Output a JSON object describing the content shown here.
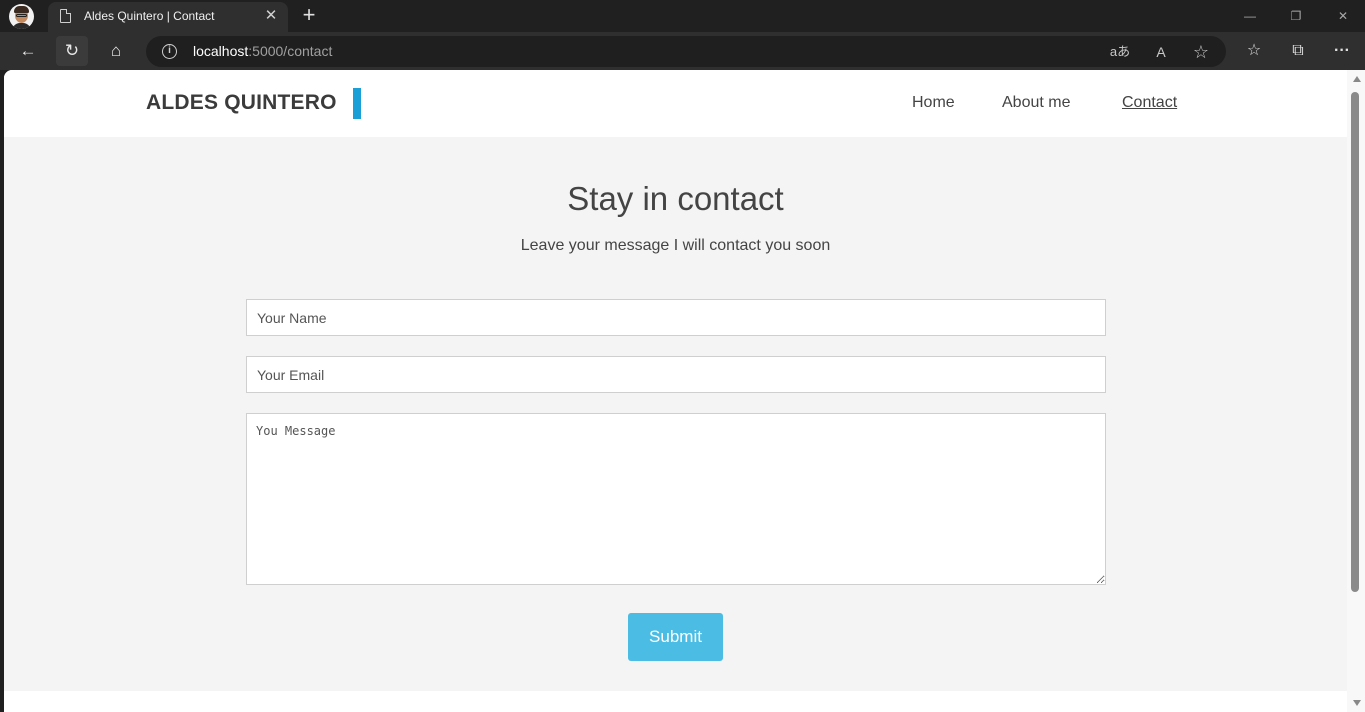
{
  "browser": {
    "tab_title": "Aldes Quintero | Contact",
    "tab_close_icon": "close-icon",
    "new_tab_icon": "plus-icon",
    "url_host": "localhost",
    "url_rest": ":5000/contact",
    "window_controls": {
      "minimize": "—",
      "restore": "❐",
      "close": "✕"
    },
    "toolbar_glyphs": {
      "back": "←",
      "reload": "↻",
      "home": "⌂",
      "info": "i",
      "translate": "aあ",
      "read_aloud": "A",
      "favorite": "☆",
      "favorites": "☆",
      "collections": "⧉",
      "more": "···"
    }
  },
  "site": {
    "logo": "ALDES QUINTERO",
    "accent_color": "#1a9fd6",
    "nav": {
      "home": "Home",
      "about": "About me",
      "contact": "Contact"
    }
  },
  "contact": {
    "heading": "Stay in contact",
    "subheading": "Leave your message I will contact you soon",
    "name_placeholder": "Your Name",
    "email_placeholder": "Your Email",
    "message_placeholder": "You Message",
    "submit_label": "Submit",
    "submit_color": "#4bbde4"
  }
}
